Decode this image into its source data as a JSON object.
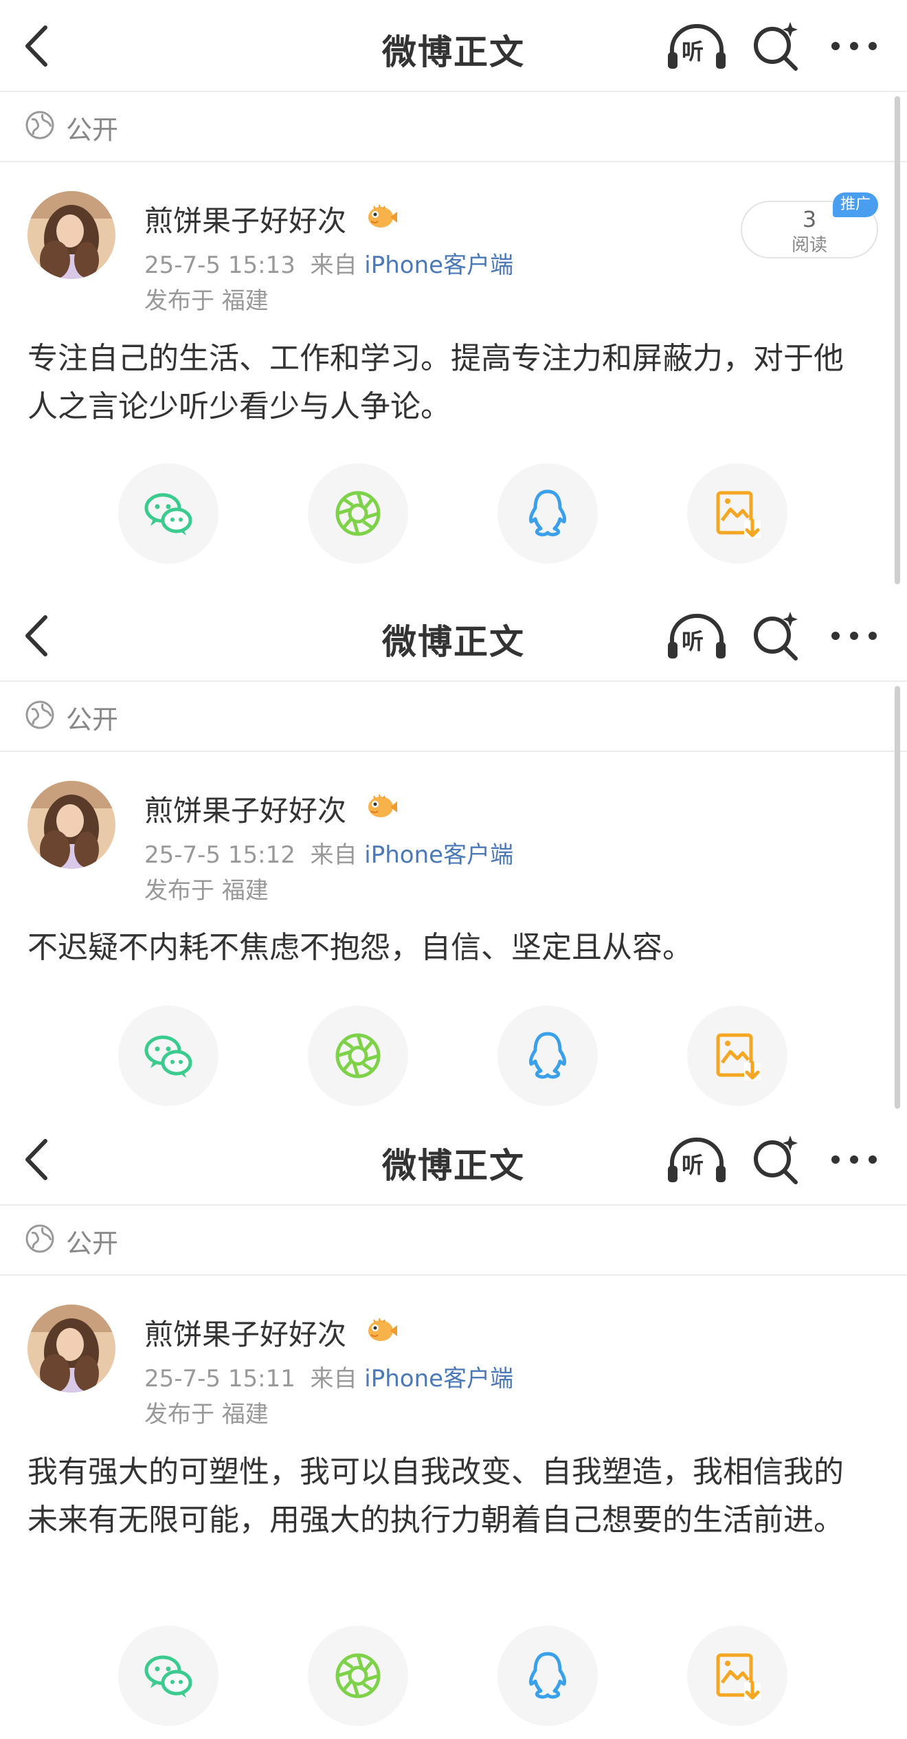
{
  "colors": {
    "wechat": "#3ccb8f",
    "moments": "#7ed24a",
    "qq": "#3aa0ea",
    "save_image": "#f5a623",
    "link": "#4b79b8",
    "promo": "#4a9ef0"
  },
  "panels": [
    {
      "nav": {
        "title": "微博正文",
        "listen_label": "听",
        "icons": [
          "back-arrow-icon",
          "headphones-icon",
          "search-sparkle-icon",
          "more-dots-icon"
        ]
      },
      "privacy": {
        "icon": "globe-icon",
        "label": "公开"
      },
      "post": {
        "username": "煎饼果子好好次",
        "badge_icon": "pufferfish-emoji-icon",
        "time": "25-7-5 15:13",
        "source_prefix": "来自",
        "source": "iPhone客户端",
        "location": "发布于 福建",
        "text": "专注自己的生活、工作和学习。提高专注力和屏蔽力，对于他人之言论少听少看少与人争论。"
      },
      "read": {
        "count": "3",
        "label": "阅读",
        "promo": "推广"
      },
      "share": [
        "wechat-icon",
        "moments-icon",
        "qq-icon",
        "save-image-icon"
      ]
    },
    {
      "nav": {
        "title": "微博正文",
        "listen_label": "听"
      },
      "privacy": {
        "label": "公开"
      },
      "post": {
        "username": "煎饼果子好好次",
        "time": "25-7-5 15:12",
        "source_prefix": "来自",
        "source": "iPhone客户端",
        "location": "发布于 福建",
        "text": "不迟疑不内耗不焦虑不抱怨，自信、坚定且从容。"
      }
    },
    {
      "nav": {
        "title": "微博正文",
        "listen_label": "听"
      },
      "privacy": {
        "label": "公开"
      },
      "post": {
        "username": "煎饼果子好好次",
        "time": "25-7-5 15:11",
        "source_prefix": "来自",
        "source": "iPhone客户端",
        "location": "发布于 福建",
        "text": "我有强大的可塑性，我可以自我改变、自我塑造，我相信我的未来有无限可能，用强大的执行力朝着自己想要的生活前进。"
      }
    }
  ]
}
